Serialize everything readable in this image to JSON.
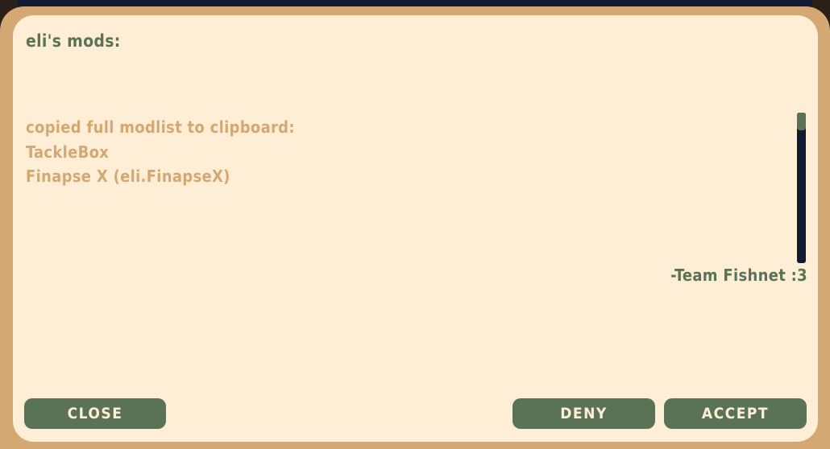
{
  "dialog": {
    "title": "eli's mods:",
    "log_lines": [
      "copied full modlist to clipboard:",
      "TackleBox",
      "Finapse X (eli.FinapseX)"
    ],
    "signature": "-Team Fishnet :3"
  },
  "buttons": {
    "close_label": "CLOSE",
    "deny_label": "DENY",
    "accept_label": "ACCEPT"
  },
  "colors": {
    "panel_bg": "#ffeed6",
    "frame": "#d4a872",
    "accent_green": "#5a7356",
    "navy": "#101a33",
    "log_text": "#d4a872"
  }
}
